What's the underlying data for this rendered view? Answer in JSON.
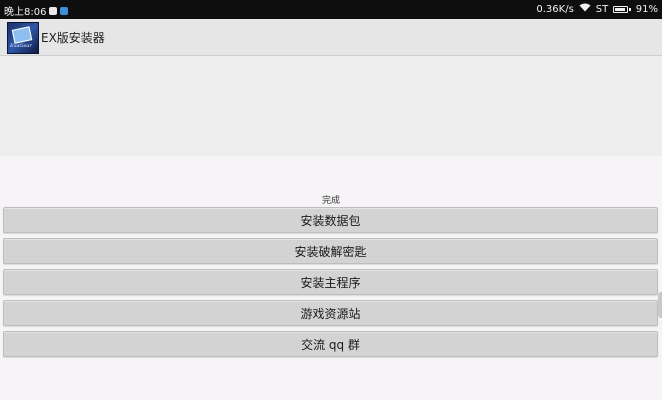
{
  "status_bar": {
    "time": "晚上8:06",
    "speed": "0.36K/s",
    "carrier": "ST",
    "battery": "91%",
    "battery_level": 0.91,
    "icons": [
      "notification-icon",
      "qq-icon",
      "wifi-icon",
      "battery-icon"
    ]
  },
  "app": {
    "logo_text": "ExaGear",
    "title": "EX版安装器"
  },
  "main": {
    "status": "完成",
    "buttons": [
      {
        "label": "安装数据包"
      },
      {
        "label": "安装破解密匙"
      },
      {
        "label": "安装主程序"
      },
      {
        "label": "游戏资源站"
      },
      {
        "label": "交流 qq 群"
      }
    ]
  },
  "colors": {
    "status_bar_bg": "#0e0e0e",
    "action_bar_bg": "#e6e6e6",
    "button_bg": "#d3d3d3",
    "page_bg": "#f6f4f6"
  }
}
